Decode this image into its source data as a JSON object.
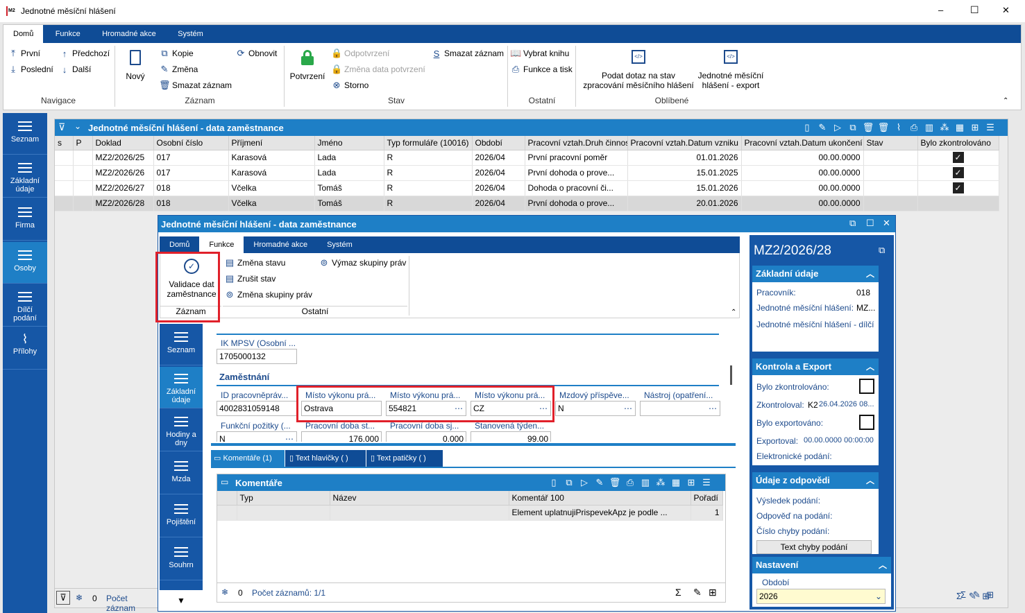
{
  "window": {
    "title": "Jednotné měsíční hlášení",
    "app_icon": "k2-logo",
    "minimize": "–",
    "maximize": "☐",
    "close": "✕"
  },
  "ribbon": {
    "tabs": [
      "Domů",
      "Funkce",
      "Hromadné akce",
      "Systém"
    ],
    "navigace": {
      "prvni": "První",
      "predchozi": "Předchozí",
      "posledni": "Poslední",
      "dalsi": "Další",
      "label": "Navigace"
    },
    "zaznam": {
      "novy": "Nový",
      "kopie": "Kopie",
      "zmena": "Změna",
      "smazat": "Smazat záznam",
      "obnovit": "Obnovit",
      "label": "Záznam"
    },
    "stav": {
      "potvrzeni": "Potvrzení",
      "odpotvrzeni": "Odpotvrzení",
      "zmena_data": "Změna data potvrzení",
      "storno": "Storno",
      "smazat": "Smazat záznam",
      "label": "Stav"
    },
    "ostatni": {
      "vybrat_knihu": "Vybrat knihu",
      "funkce_tisk": "Funkce a tisk",
      "label": "Ostatní"
    },
    "oblibene": {
      "podat_dotaz_1": "Podat dotaz na stav",
      "podat_dotaz_2": "zpracování měsíčního hlášení",
      "export_1": "Jednotné měsíční",
      "export_2": "hlášení - export",
      "label": "Oblíbené"
    }
  },
  "sidebar": [
    "Seznam",
    "Základní údaje",
    "Firma",
    "Osoby",
    "Dílčí podání",
    "Přílohy"
  ],
  "list": {
    "title": "Jednotné měsíční hlášení - data zaměstnance",
    "columns": [
      "s",
      "P",
      "Doklad",
      "Osobní číslo",
      "Příjmení",
      "Jméno",
      "Typ formuláře (10016)",
      "Období",
      "Pracovní vztah.Druh činnosti",
      "Pracovní vztah.Datum vzniku",
      "Pracovní vztah.Datum ukončení",
      "Stav",
      "Bylo zkontrolováno"
    ],
    "rows": [
      {
        "doklad": "MZ2/2026/25",
        "osobni": "017",
        "prijmeni": "Karasová",
        "jmeno": "Lada",
        "typ": "R",
        "obdobi": "2026/04",
        "druh": "První pracovní poměr",
        "vznik": "01.01.2026",
        "ukonceni": "00.00.0000",
        "check": "✓"
      },
      {
        "doklad": "MZ2/2026/26",
        "osobni": "017",
        "prijmeni": "Karasová",
        "jmeno": "Lada",
        "typ": "R",
        "obdobi": "2026/04",
        "druh": "První dohoda o prove...",
        "vznik": "15.01.2025",
        "ukonceni": "00.00.0000",
        "check": "✓"
      },
      {
        "doklad": "MZ2/2026/27",
        "osobni": "018",
        "prijmeni": "Včelka",
        "jmeno": "Tomáš",
        "typ": "R",
        "obdobi": "2026/04",
        "druh": "Dohoda o pracovní či...",
        "vznik": "15.01.2026",
        "ukonceni": "00.00.0000",
        "check": "✓"
      },
      {
        "doklad": "MZ2/2026/28",
        "osobni": "018",
        "prijmeni": "Včelka",
        "jmeno": "Tomáš",
        "typ": "R",
        "obdobi": "2026/04",
        "druh": "První dohoda o prove...",
        "vznik": "20.01.2026",
        "ukonceni": "00.00.0000",
        "check": ""
      }
    ],
    "footer_count": "0",
    "footer_label": "Počet záznam"
  },
  "detail": {
    "title": "Jednotné měsíční hlášení - data zaměstnance",
    "tabs": [
      "Domů",
      "Funkce",
      "Hromadné akce",
      "Systém"
    ],
    "ribbon": {
      "validace_1": "Validace dat",
      "validace_2": "zaměstnance",
      "zaznam_label": "Záznam",
      "zmena_stavu": "Změna stavu",
      "zrusit_stav": "Zrušit stav",
      "zmena_skupiny": "Změna skupiny práv",
      "vymaz_skupiny": "Výmaz skupiny práv",
      "ostatni_label": "Ostatní"
    },
    "sidebar": [
      "Seznam",
      "Základní údaje",
      "Hodiny a dny",
      "Mzda",
      "Pojištění",
      "Souhrn"
    ],
    "form": {
      "ik_label": "IK MPSV (Osobní ...",
      "ik_value": "1705000132",
      "section": "Zaměstnání",
      "id_label": "ID pracovněpráv...",
      "id_value": "4002831059148",
      "misto1_label": "Místo výkonu prá...",
      "misto1_value": "Ostrava",
      "misto2_label": "Místo výkonu prá...",
      "misto2_value": "554821",
      "misto3_label": "Místo výkonu prá...",
      "misto3_value": "CZ",
      "mzdovy_label": "Mzdový příspěve...",
      "mzdovy_value": "N",
      "nastroj_label": "Nástroj (opatření...",
      "nastroj_value": "",
      "funkcni_label": "Funkční požitky (...",
      "funkcni_value": "N",
      "doba1_label": "Pracovní doba st...",
      "doba1_value": "176,000",
      "doba2_label": "Pracovní doba sj...",
      "doba2_value": "0,000",
      "tyden_label": "Stanovená týden...",
      "tyden_value": "99,00"
    },
    "bottom_tabs": [
      "Komentáře (1)",
      "Text hlavičky ( )",
      "Text patičky ( )"
    ],
    "comments": {
      "title": "Komentáře",
      "columns": [
        "Typ",
        "Název",
        "Komentář 100",
        "Pořadí"
      ],
      "rows": [
        {
          "typ": "",
          "nazev": "",
          "komentar": "Element uplatnujiPrispevekApz je podle ...",
          "poradi": "1"
        }
      ],
      "footer_count": "0",
      "footer_label": "Počet záznamů: 1/1"
    },
    "right": {
      "doc_id": "MZ2/2026/28",
      "zakladni": {
        "title": "Základní údaje",
        "pracovnik_label": "Pracovník:",
        "pracovnik_value": "018",
        "jmh_label": "Jednotné měsíční hlášení:",
        "jmh_value": "MZ...",
        "jmh_dilci": "Jednotné měsíční hlášení - dílčí p"
      },
      "kontrola": {
        "title": "Kontrola a Export",
        "zkontrolovano": "Bylo zkontrolováno:",
        "zkontroloval_label": "Zkontroloval:",
        "zkontroloval_user": "K2",
        "zkontroloval_date": "26.04.2026 08...",
        "exportovano": "Bylo exportováno:",
        "exportoval_label": "Exportoval:",
        "exportoval_value": "00.00.0000 00:00:00",
        "elektronicke": "Elektronické podání:"
      },
      "odpoved": {
        "title": "Údaje z odpovědi",
        "vysledek": "Výsledek podání:",
        "odpoved": "Odpověď na podání:",
        "cislo": "Číslo chyby podání:",
        "btn": "Text chyby podání"
      },
      "nastaveni": {
        "title": "Nastavení",
        "obdobi_label": "Období",
        "obdobi_value": "2026"
      }
    }
  },
  "colors": {
    "accent": "#0f4c96",
    "header_blue": "#1e7fc6",
    "sidebar": "#1657a6",
    "highlight": "#e0202a"
  }
}
